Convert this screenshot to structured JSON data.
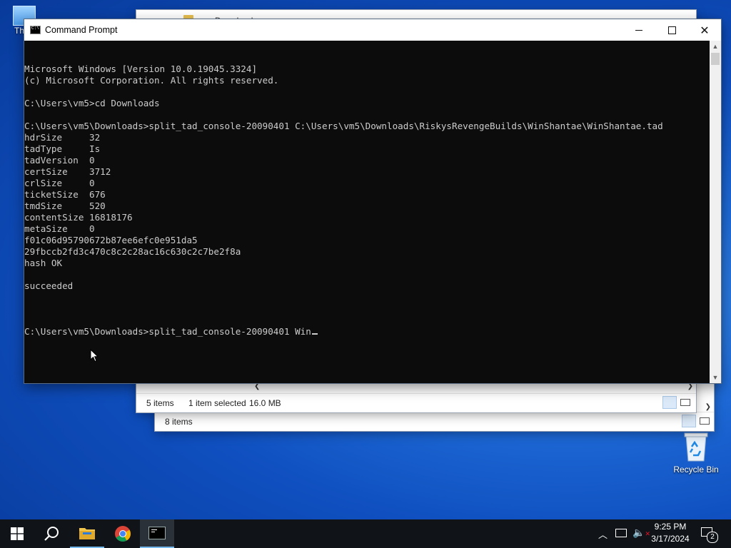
{
  "desktop": {
    "top_left_icon_label": "Th",
    "recycle_bin_label": "Recycle Bin"
  },
  "explorer_back": {
    "status_items": "8 items"
  },
  "explorer_front": {
    "title_partial": "Downloads",
    "status_items": "5 items",
    "status_selected": "1 item selected",
    "status_size": "16.0 MB"
  },
  "cmd": {
    "title": "Command Prompt",
    "lines": [
      "Microsoft Windows [Version 10.0.19045.3324]",
      "(c) Microsoft Corporation. All rights reserved.",
      "",
      "C:\\Users\\vm5>cd Downloads",
      "",
      "C:\\Users\\vm5\\Downloads>split_tad_console-20090401 C:\\Users\\vm5\\Downloads\\RiskysRevengeBuilds\\WinShantae\\WinShantae.tad",
      "hdrSize     32",
      "tadType     Is",
      "tadVersion  0",
      "certSize    3712",
      "crlSize     0",
      "ticketSize  676",
      "tmdSize     520",
      "contentSize 16818176",
      "metaSize    0",
      "f01c06d95790672b87ee6efc0e951da5",
      "29fbccb2fd3c470c8c2c28ac16c630c2c7be2f8a",
      "hash OK",
      "",
      "succeeded",
      ""
    ],
    "prompt_line": "C:\\Users\\vm5\\Downloads>split_tad_console-20090401 Win"
  },
  "taskbar": {
    "clock_time": "9:25 PM",
    "clock_date": "3/17/2024",
    "notification_count": "2",
    "accent": "#76b9ed"
  }
}
